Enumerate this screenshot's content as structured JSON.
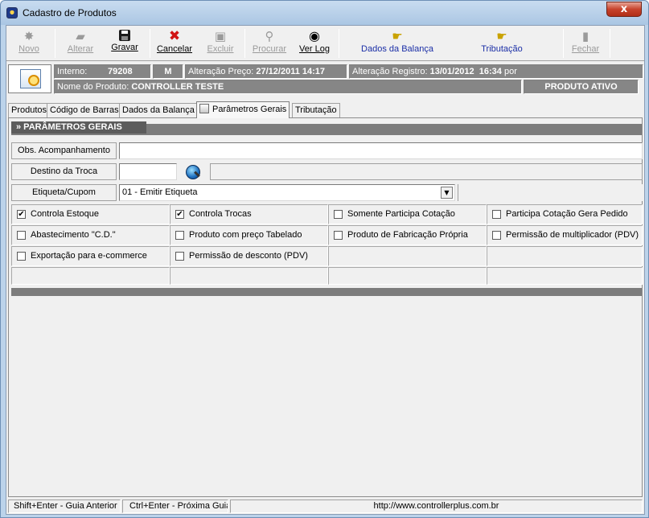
{
  "window": {
    "title": "Cadastro de Produtos",
    "close_label": "x"
  },
  "toolbar": {
    "novo": "Novo",
    "alterar": "Alterar",
    "gravar": "Gravar",
    "cancelar": "Cancelar",
    "excluir": "Excluir",
    "procurar": "Procurar",
    "ver_log": "Ver Log",
    "dados_balanca": "Dados da Balança",
    "tributacao": "Tributação",
    "fechar": "Fechar",
    "icons": {
      "novo": "star-burst-icon",
      "alterar": "edit-icon",
      "gravar": "floppy-disk-icon",
      "cancelar": "red-x-icon",
      "excluir": "trash-icon",
      "procurar": "magnifier-icon",
      "ver_log": "eye-icon",
      "dados_balanca": "hand-pointer-icon",
      "tributacao": "hand-pointer-icon",
      "fechar": "door-icon"
    }
  },
  "info": {
    "interno_label": "Interno:",
    "interno_value": "79208",
    "tipo": "M",
    "alteracao_preco_label": "Alteração Preço:",
    "alteracao_preco_value": "27/12/2011 14:17",
    "alteracao_registro_label": "Alteração Registro:",
    "alteracao_registro_value": "13/01/2012  16:34",
    "por_label": "por",
    "nome_label": "Nome do Produto:",
    "nome_value": "CONTROLLER TESTE",
    "status": "PRODUTO ATIVO"
  },
  "tabs": [
    {
      "label": "Produtos"
    },
    {
      "label": "Código de Barras"
    },
    {
      "label": "Dados da Balança"
    },
    {
      "label": "Parâmetros Gerais"
    },
    {
      "label": "Tributação"
    }
  ],
  "parametros": {
    "section_title": "» PARÂMETROS GERAIS",
    "obs_label": "Obs. Acompanhamento",
    "obs_value": "",
    "destino_label": "Destino da Troca",
    "destino_value": "",
    "etiqueta_label": "Etiqueta/Cupom",
    "etiqueta_value": "01 - Emitir Etiqueta",
    "checkboxes": [
      {
        "label": "Controla Estoque",
        "checked": true,
        "mark": "✔"
      },
      {
        "label": "Controla Trocas",
        "checked": true,
        "mark": "✔"
      },
      {
        "label": "Somente Participa Cotação",
        "checked": false,
        "mark": ""
      },
      {
        "label": "Participa Cotação Gera Pedido",
        "checked": false,
        "mark": ""
      },
      {
        "label": "Abastecimento \"C.D.\"",
        "checked": false,
        "mark": ""
      },
      {
        "label": "Produto com preço Tabelado",
        "checked": false,
        "mark": ""
      },
      {
        "label": "Produto de Fabricação Própria",
        "checked": false,
        "mark": ""
      },
      {
        "label": "Permissão de multiplicador (PDV)",
        "checked": false,
        "mark": ""
      },
      {
        "label": "Exportação para e-commerce",
        "checked": false,
        "mark": ""
      },
      {
        "label": "Permissão de desconto (PDV)",
        "checked": false,
        "mark": ""
      }
    ]
  },
  "status_bar": {
    "prev": "Shift+Enter - Guia Anterior",
    "next": "Ctrl+Enter - Próxima Guia",
    "url": "http://www.controllerplus.com.br"
  },
  "colors": {
    "title_bar": "#bcd3ea",
    "info_cell": "#868686",
    "section_bar": "#7c7c7c",
    "link_blue": "#1a2ea6",
    "close_red": "#c7432c"
  }
}
